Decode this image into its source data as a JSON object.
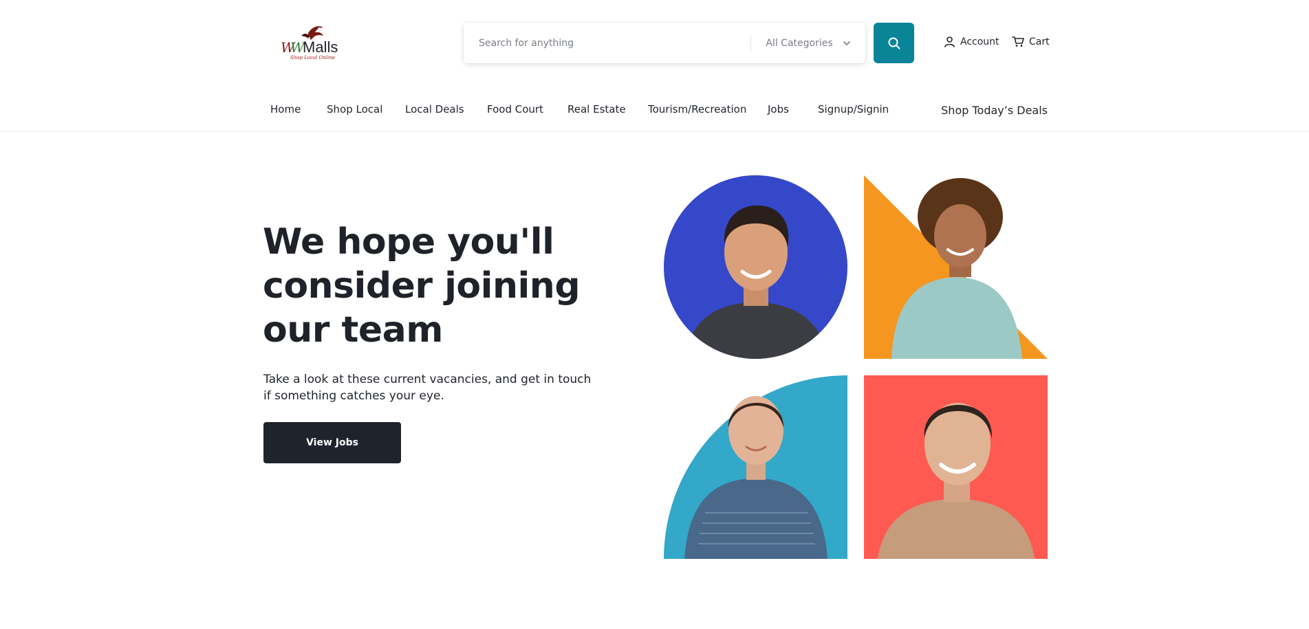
{
  "header": {
    "logo": {
      "brand": "WWMalls",
      "tagline": "Shop Local Online",
      "icon": "eagle-logo"
    },
    "search": {
      "placeholder": "Search for anything",
      "value": ""
    },
    "category": {
      "selected": "All Categories"
    },
    "account_label": "Account",
    "cart_label": "Cart"
  },
  "nav": {
    "items": [
      {
        "label": "Home"
      },
      {
        "label": "Shop Local"
      },
      {
        "label": "Local Deals"
      },
      {
        "label": "Food Court"
      },
      {
        "label": "Real Estate"
      },
      {
        "label": "Tourism/Recreation"
      },
      {
        "label": "Jobs"
      },
      {
        "label": "Signup/Signin"
      }
    ],
    "deals_label": "Shop Today’s Deals"
  },
  "hero": {
    "title": "We hope you'll consider joining our team",
    "text": "Take a look at these current vacancies, and get in touch if something catches your eye.",
    "button_label": "View Jobs"
  },
  "tiles": [
    {
      "shape": "circle",
      "color": "#3548c9"
    },
    {
      "shape": "triangle",
      "color": "#f5961f"
    },
    {
      "shape": "quarter-circle",
      "color": "#33a8c9"
    },
    {
      "shape": "square",
      "color": "#ff5a52"
    }
  ],
  "colors": {
    "accent": "#0a8598",
    "button_dark": "#1f242c",
    "text": "#1f2329"
  }
}
